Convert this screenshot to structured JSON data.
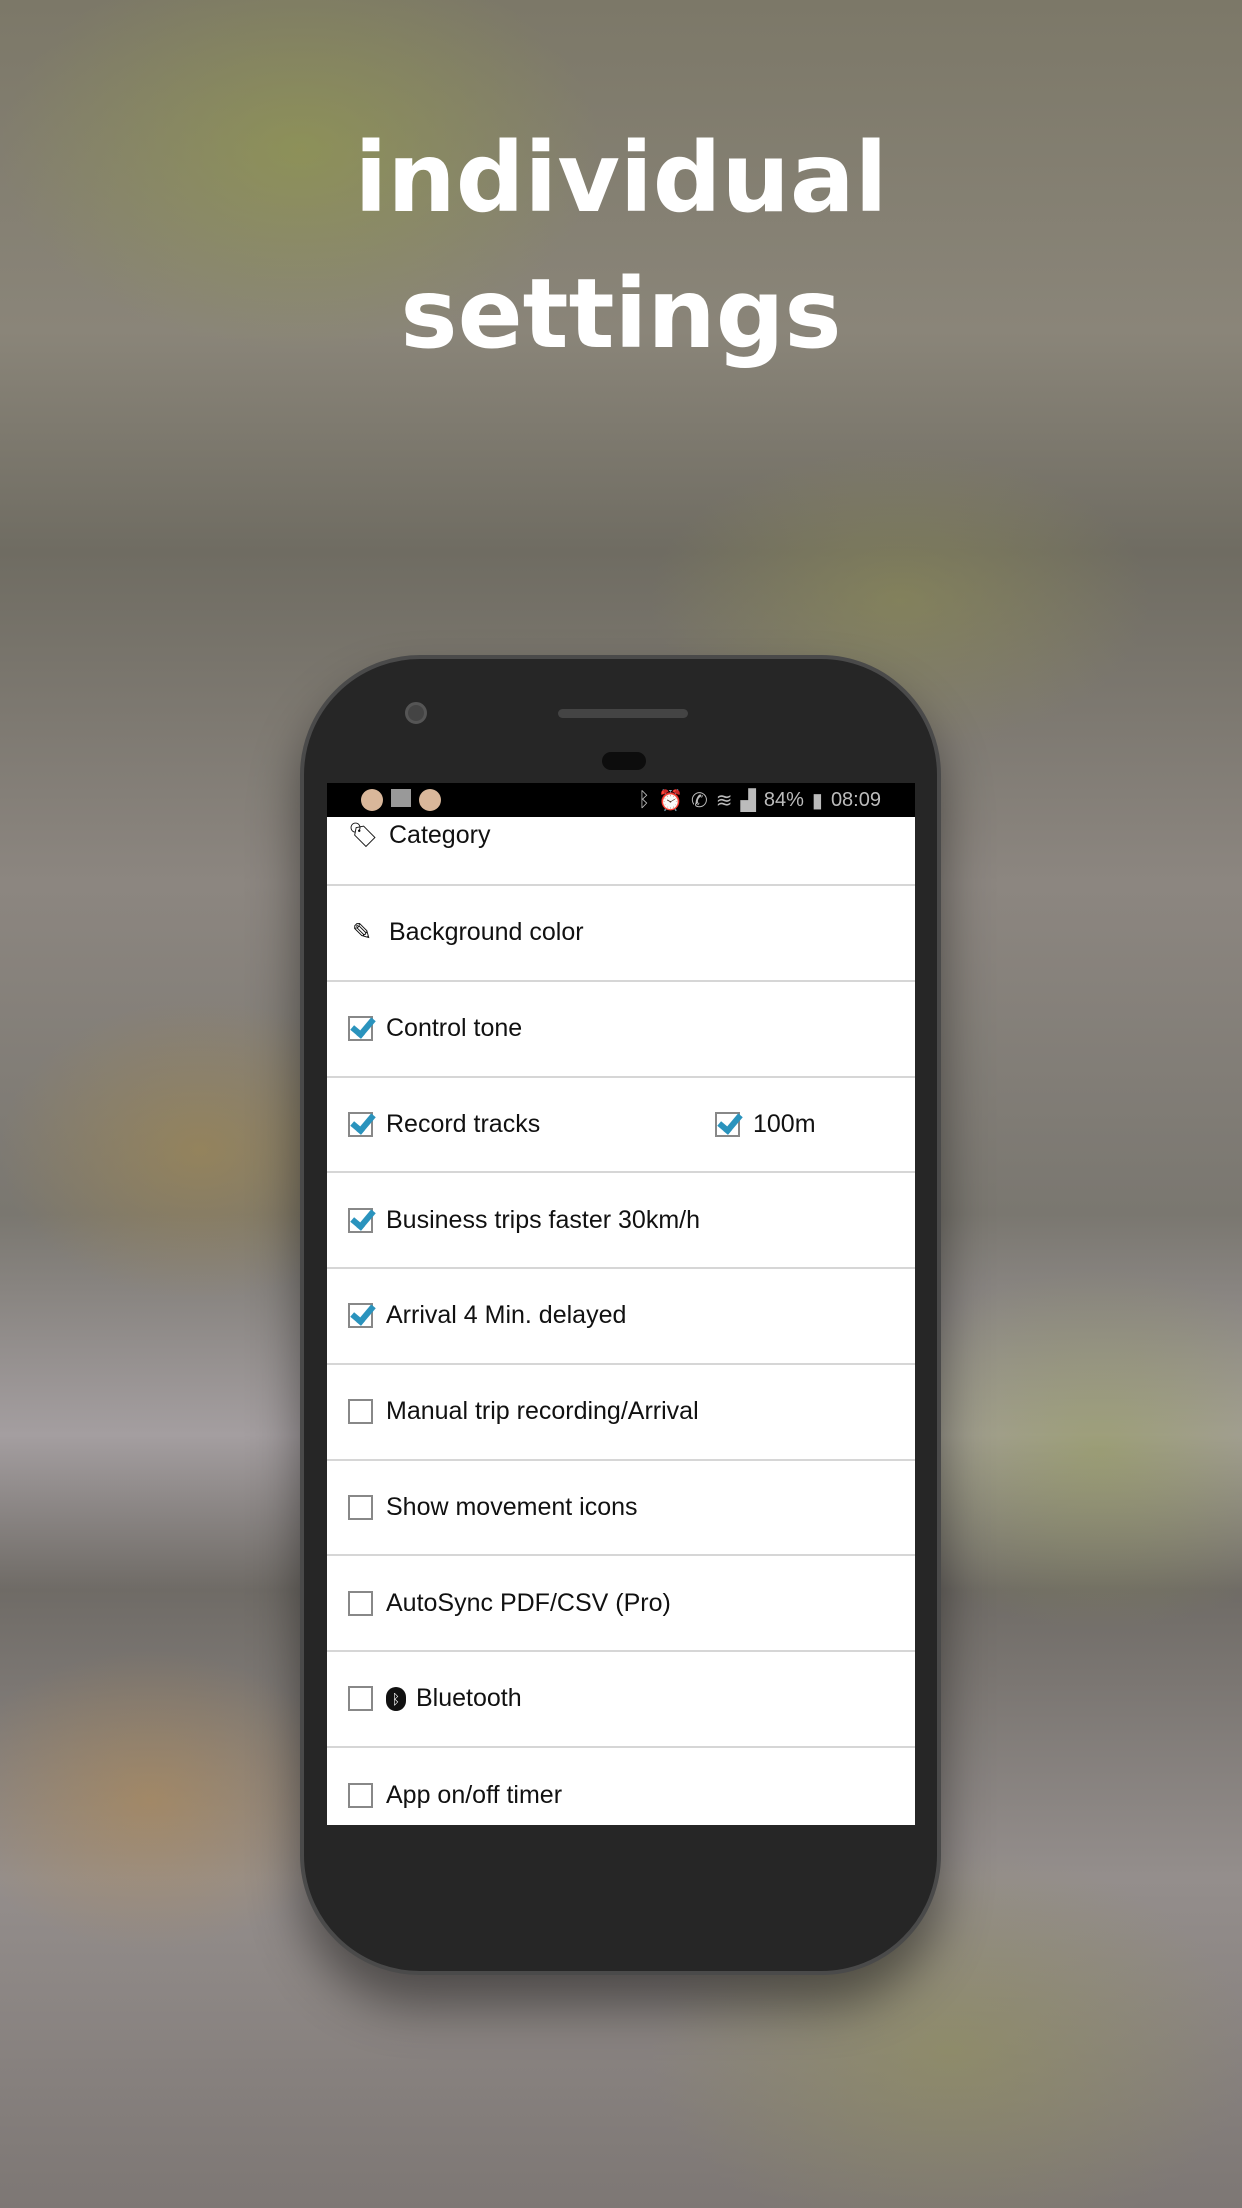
{
  "headline": [
    "individual",
    "settings"
  ],
  "status_bar": {
    "battery": "84%",
    "time": "08:09",
    "icons": [
      "grs-app-icon",
      "image-icon",
      "grs-app-icon",
      "bluetooth-icon",
      "alarm-icon",
      "wifi-call-icon",
      "wifi-icon",
      "signal-icon",
      "battery-icon"
    ]
  },
  "settings": [
    {
      "label": "Category",
      "icon": "tag-icon"
    },
    {
      "label": "Background color",
      "icon": "eyedropper-icon"
    },
    {
      "label": "Control tone",
      "checked": true
    },
    {
      "label": "Record tracks",
      "checked": true,
      "extra": {
        "label": "100m",
        "checked": true
      }
    },
    {
      "label": "Business trips faster 30km/h",
      "checked": true
    },
    {
      "label": "Arrival 4 Min. delayed",
      "checked": true
    },
    {
      "label": "Manual trip recording/Arrival",
      "checked": false
    },
    {
      "label": "Show movement icons",
      "checked": false
    },
    {
      "label": "AutoSync PDF/CSV (Pro)",
      "checked": false
    },
    {
      "label": "Bluetooth",
      "checked": false,
      "icon": "bluetooth-icon"
    },
    {
      "label": "App on/off timer",
      "checked": false
    }
  ],
  "colors": {
    "accent": "#2a93bd"
  }
}
